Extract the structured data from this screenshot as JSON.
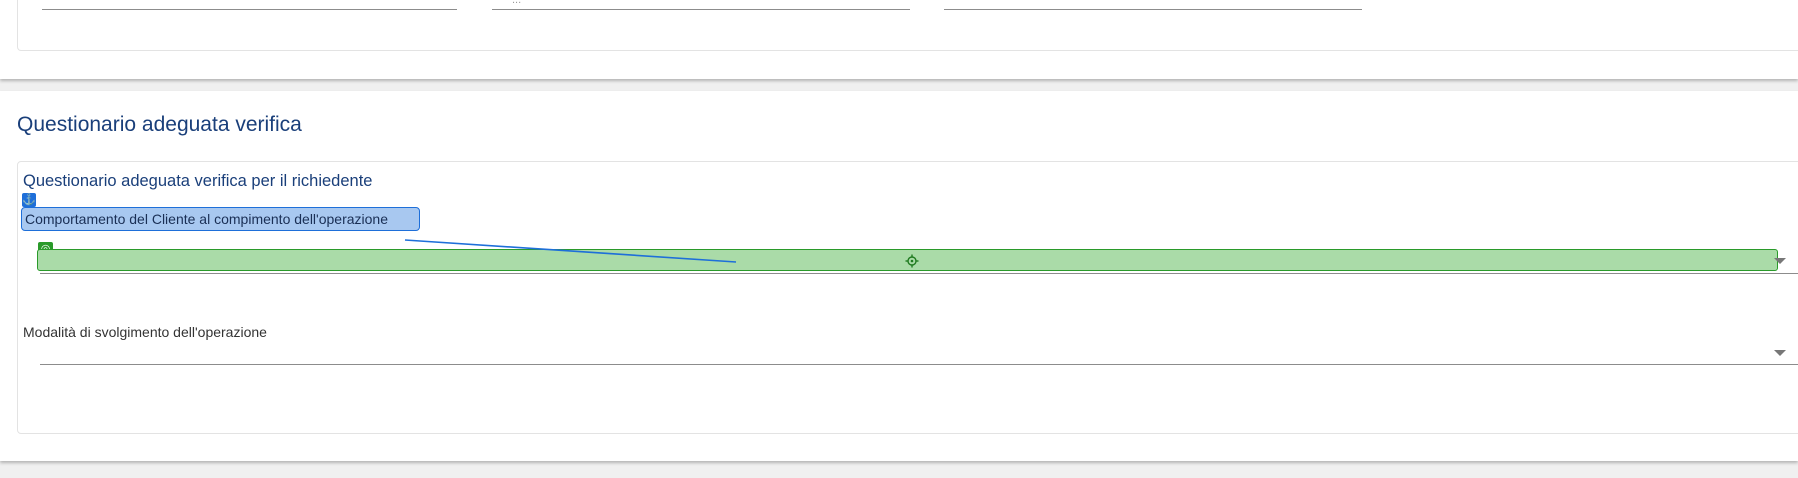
{
  "top_card": {
    "fields": [
      {
        "value": ""
      },
      {
        "value": "..."
      },
      {
        "value": ""
      }
    ]
  },
  "section": {
    "title": "Questionario adeguata verifica",
    "subtitle": "Questionario adeguata verifica per il richiedente",
    "fields": [
      {
        "label": "Comportamento del Cliente al compimento dell'operazione",
        "value": "",
        "label_badge_icon": "anchor-icon",
        "field_badge_icon": "target-icon",
        "center_icon": "crosshair-icon"
      },
      {
        "label": "Modalità di svolgimento dell'operazione",
        "value": ""
      }
    ]
  },
  "colors": {
    "title": "#1a3f7a",
    "anchor_highlight": "#1e6fd9",
    "target_highlight": "#2a9a2a"
  }
}
